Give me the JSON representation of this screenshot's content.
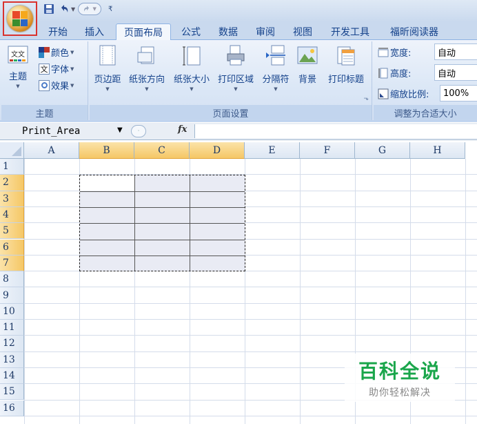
{
  "qat": {
    "save_icon": "save-icon",
    "undo_icon": "undo-icon",
    "redo_icon": "redo-icon",
    "customize_icon": "customize-qat-icon"
  },
  "tabs": [
    {
      "label": "开始"
    },
    {
      "label": "插入"
    },
    {
      "label": "页面布局",
      "active": true
    },
    {
      "label": "公式"
    },
    {
      "label": "数据"
    },
    {
      "label": "审阅"
    },
    {
      "label": "视图"
    },
    {
      "label": "开发工具"
    },
    {
      "label": "福昕阅读器"
    }
  ],
  "ribbon": {
    "theme_group": {
      "label": "主题",
      "themes_button": "主题",
      "colors_button": "颜色",
      "fonts_button": "字体",
      "effects_button": "效果"
    },
    "page_setup_group": {
      "label": "页面设置",
      "margins": "页边距",
      "orientation": "纸张方向",
      "size": "纸张大小",
      "print_area": "打印区域",
      "breaks": "分隔符",
      "background": "背景",
      "print_titles": "打印标题"
    },
    "scale_group": {
      "label": "调整为合适大小",
      "width_label": "宽度:",
      "width_value": "自动",
      "height_label": "高度:",
      "height_value": "自动",
      "scale_label": "缩放比例:",
      "scale_value": "100%"
    }
  },
  "formula_bar": {
    "name_box": "Print_Area",
    "fx_label": "fx",
    "formula": ""
  },
  "columns": [
    "A",
    "B",
    "C",
    "D",
    "E",
    "F",
    "G",
    "H"
  ],
  "selected_columns": [
    "B",
    "C",
    "D"
  ],
  "rows": [
    "1",
    "2",
    "3",
    "4",
    "5",
    "6",
    "7",
    "8",
    "9",
    "10",
    "11",
    "12",
    "13",
    "14",
    "15",
    "16"
  ],
  "selected_rows": [
    "2",
    "3",
    "4",
    "5",
    "6",
    "7"
  ],
  "watermark": {
    "title": "百科全说",
    "subtitle": "助你轻松解决"
  },
  "colors": {
    "ribbon_bg": "#dbe7f6",
    "header_selected": "#f5c766",
    "selection_fill": "#e9ebf4",
    "highlight_border": "#d9322e",
    "watermark_green": "#1aa64b"
  }
}
